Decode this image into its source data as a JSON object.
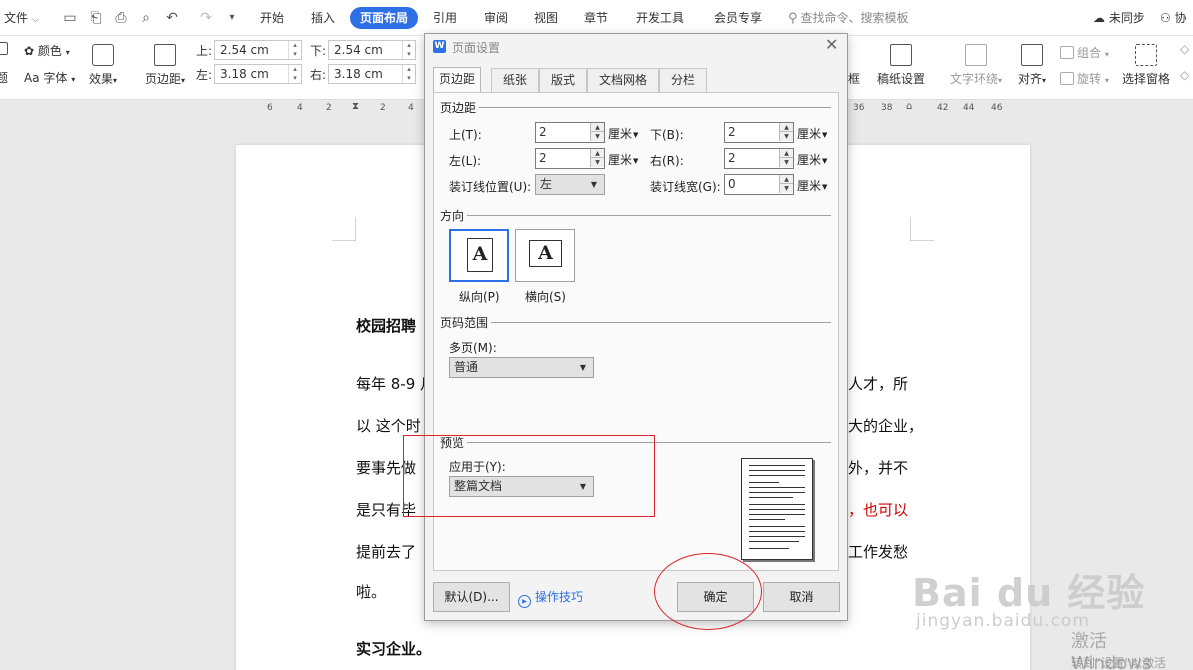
{
  "menubar": {
    "file": "文件",
    "tabs": [
      "开始",
      "插入",
      "页面布局",
      "引用",
      "审阅",
      "视图",
      "章节",
      "开发工具",
      "会员专享"
    ],
    "active_tab": "页面布局",
    "search": "查找命令、搜索模板",
    "sync": "未同步",
    "collab": "协"
  },
  "ribbon": {
    "left_cut": "题",
    "color": "颜色",
    "font": "Aa 字体",
    "effects": "效果",
    "margins": "页边距",
    "top_lbl": "上:",
    "top_val": "2.54 cm",
    "bottom_lbl": "下:",
    "bottom_val": "2.54 cm",
    "left_lbl": "左:",
    "left_val": "3.18 cm",
    "right_lbl": "右:",
    "right_val": "3.18 cm",
    "border_cut": "框",
    "draft": "稿纸设置",
    "wrap": "文字环绕",
    "align": "对齐",
    "group": "组合",
    "rotate": "旋转",
    "selection_pane": "选择窗格"
  },
  "ruler": {
    "left_ticks": [
      "6",
      "4",
      "2",
      "2",
      "4"
    ],
    "right_ticks": [
      "36",
      "38",
      "40",
      "42",
      "44",
      "46"
    ]
  },
  "document": {
    "heading": "校园招聘",
    "p1_left": "每年 8-9 月",
    "p1_right": "人才，所",
    "p2_left": "以 这个时",
    "p2_right": "大的企业，",
    "p3_left": "要事先做",
    "p3_right": "外，并不",
    "p4_left": "是只有毕",
    "p4_right": "，也可以",
    "p5_left": "提前去了",
    "p5_right": "工作发愁",
    "p6": "啦。",
    "heading2": "实习企业。"
  },
  "dialog": {
    "title": "页面设置",
    "tabs": [
      "页边距",
      "纸张",
      "版式",
      "文档网格",
      "分栏"
    ],
    "section_margins": "页边距",
    "top_label": "上(T):",
    "top_value": "2",
    "bottom_label": "下(B):",
    "bottom_value": "2",
    "left_label": "左(L):",
    "left_value": "2",
    "right_label": "右(R):",
    "right_value": "2",
    "unit": "厘米",
    "gutter_pos_label": "装订线位置(U):",
    "gutter_pos_value": "左",
    "gutter_width_label": "装订线宽(G):",
    "gutter_width_value": "0",
    "section_orientation": "方向",
    "portrait": "纵向(P)",
    "landscape": "横向(S)",
    "section_pages": "页码范围",
    "multi_label": "多页(M):",
    "multi_value": "普通",
    "section_preview": "预览",
    "apply_label": "应用于(Y):",
    "apply_value": "整篇文档",
    "default_btn": "默认(D)...",
    "tips": "操作技巧",
    "ok_btn": "确定",
    "cancel_btn": "取消"
  },
  "watermark": {
    "baidu": "Bai du 经验",
    "url": "jingyan.baidu.com",
    "activate": "激活 Windows",
    "activate_sub": "转到\"设置\"以激活"
  }
}
